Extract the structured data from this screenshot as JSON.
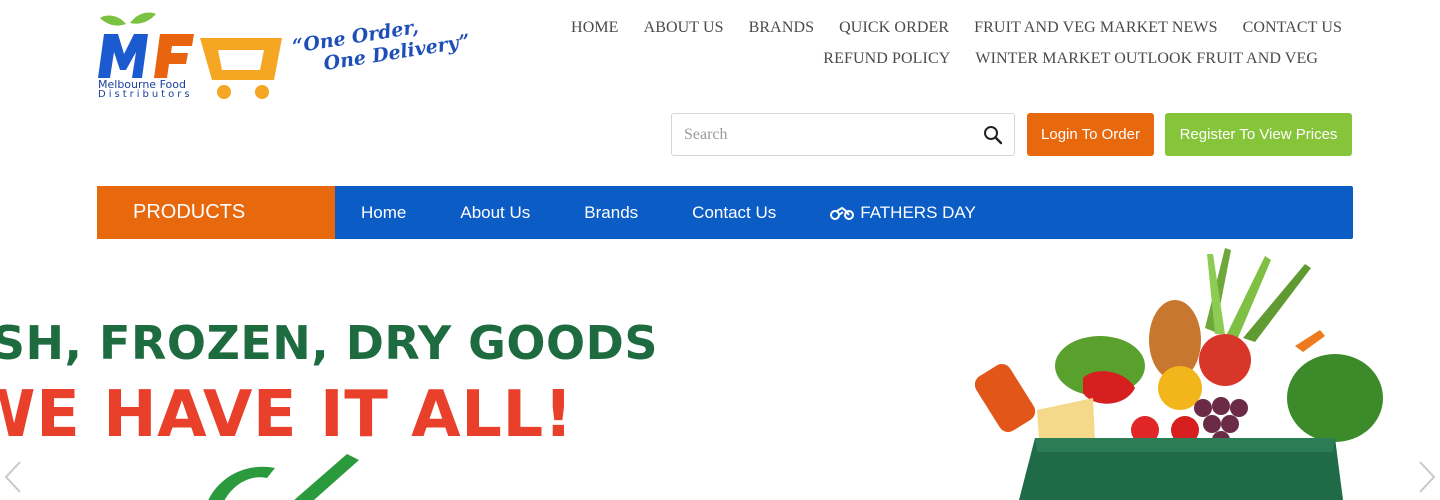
{
  "logo": {
    "letters": "MFD",
    "company_line1": "Melbourne Food",
    "company_line2": "Distributors",
    "tagline_line1": "“One Order,",
    "tagline_line2": "One Delivery”"
  },
  "top_nav": {
    "row1": [
      "HOME",
      "ABOUT US",
      "BRANDS",
      "QUICK ORDER",
      "FRUIT AND VEG MARKET NEWS",
      "CONTACT US"
    ],
    "row2": [
      "REFUND POLICY",
      "WINTER MARKET OUTLOOK FRUIT AND VEG"
    ]
  },
  "search": {
    "placeholder": "Search",
    "value": ""
  },
  "buttons": {
    "login": "Login To Order",
    "register": "Register To View Prices"
  },
  "main_nav": {
    "products": "PRODUCTS",
    "items": [
      "Home",
      "About Us",
      "Brands",
      "Contact Us",
      "FATHERS DAY"
    ]
  },
  "hero": {
    "headline_line1": "ESH, FROZEN, DRY GOODS",
    "headline_line2": "WE HAVE IT ALL!"
  },
  "colors": {
    "brand_blue": "#0b5cc4",
    "brand_orange": "#e8680e",
    "register_green": "#86c43a",
    "headline_green": "#1d6b3f",
    "headline_red": "#e8402b"
  },
  "icons": [
    "search-icon",
    "motorbike-icon",
    "chevron-left-icon",
    "chevron-right-icon"
  ]
}
